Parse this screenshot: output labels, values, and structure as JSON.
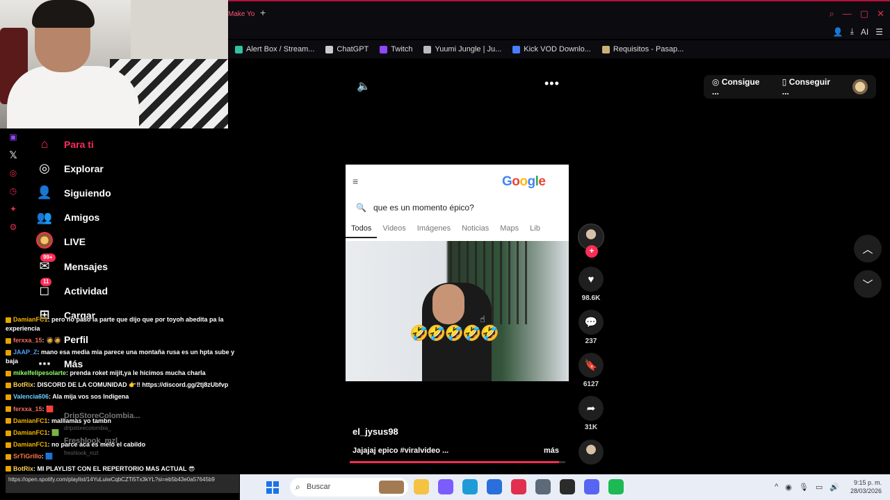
{
  "browser": {
    "tab_label": "Make Yo",
    "new_tab": "+",
    "bookmarks": [
      {
        "label": "Alert Box / Stream...",
        "icon": "streamlabs-icon",
        "color": "#31c3a2"
      },
      {
        "label": "ChatGPT",
        "icon": "chatgpt-icon",
        "color": "#cccccc"
      },
      {
        "label": "Twitch",
        "icon": "twitch-icon",
        "color": "#9146ff"
      },
      {
        "label": "Yuumi Jungle | Ju...",
        "icon": "yuumi-icon",
        "color": "#bbbbbb"
      },
      {
        "label": "Kick VOD Downlo...",
        "icon": "kick-icon",
        "color": "#4a7dff"
      },
      {
        "label": "Requisitos - Pasap...",
        "icon": "passport-icon",
        "color": "#c8b27a"
      }
    ],
    "toolbar_ai": "AI"
  },
  "nav": {
    "items": [
      {
        "label": "Para ti",
        "icon": "home-icon",
        "badge": ""
      },
      {
        "label": "Explorar",
        "icon": "compass-icon",
        "badge": ""
      },
      {
        "label": "Siguiendo",
        "icon": "following-icon",
        "badge": ""
      },
      {
        "label": "Amigos",
        "icon": "friends-icon",
        "badge": ""
      },
      {
        "label": "LIVE",
        "icon": "live-icon",
        "badge": ""
      },
      {
        "label": "Mensajes",
        "icon": "messages-icon",
        "badge": "99+"
      },
      {
        "label": "Actividad",
        "icon": "activity-icon",
        "badge": "11"
      },
      {
        "label": "Cargar",
        "icon": "upload-icon",
        "badge": ""
      },
      {
        "label": "Perfil",
        "icon": "profile-icon",
        "badge": ""
      },
      {
        "label": "Más",
        "icon": "more-icon",
        "badge": ""
      }
    ],
    "faded": [
      {
        "name": "DripStoreColombia...",
        "handle": "dripstorecolombia_"
      },
      {
        "name": "Freshlook_mzl",
        "handle": "freshlook_mzl"
      }
    ]
  },
  "chat": {
    "lines": [
      {
        "user": "DamianFC1",
        "text": ": pero no paso la parte que dijo que por toyoh abedita pa la experiencia",
        "color": "#f4b400"
      },
      {
        "user": "ferxxa_15",
        "text": ": 🧔🧔",
        "color": "#f36d5a"
      },
      {
        "user": "JAAP_Z",
        "text": ": mano esa media mia parece una montaña rusa es un hpta sube y baja",
        "color": "#4da3ff"
      },
      {
        "user": "mikelfelipesolarte",
        "text": ": prenda roket mijit,ya le hicimos mucha charla",
        "color": "#8fff6a"
      },
      {
        "user": "BotRix",
        "text": ": DISCORD DE LA COMUNIDAD 👉‼ https://discord.gg/2tj8zUbfvp",
        "color": "#ffd24a"
      },
      {
        "user": "Valencia606",
        "text": ": Ala mija vos sos Indigena",
        "color": "#6ad1ff"
      },
      {
        "user": "ferxxa_15",
        "text": ": 🟥",
        "color": "#f36d5a"
      },
      {
        "user": "DamianFC1",
        "text": ": malllamas yo tambn",
        "color": "#f4b400"
      },
      {
        "user": "DamianFC1",
        "text": ": 🟩",
        "color": "#f4b400"
      },
      {
        "user": "DamianFC1",
        "text": ": no parce aca es melo el cabildo",
        "color": "#f4b400"
      },
      {
        "user": "SrTiGrillo",
        "text": ": 🟦",
        "color": "#ff7a45"
      },
      {
        "user": "BotRix",
        "text": ": MI PLAYLIST CON EL REPERTORIO MAS ACTUAL 😎",
        "color": "#ffd24a"
      }
    ],
    "url_tooltip": "https://open.spotify.com/playlist/14YuLuiwCqbCZTi5Tx3kYL?si=eb5b43e0a57645b9"
  },
  "video": {
    "top_pill": {
      "btn1": "Consigue ...",
      "btn2": "Conseguir ..."
    },
    "google": {
      "logo_letters": [
        {
          "ch": "G",
          "color": "#4285f4"
        },
        {
          "ch": "o",
          "color": "#ea4335"
        },
        {
          "ch": "o",
          "color": "#fbbc05"
        },
        {
          "ch": "g",
          "color": "#4285f4"
        },
        {
          "ch": "l",
          "color": "#34a853"
        },
        {
          "ch": "e",
          "color": "#ea4335"
        }
      ],
      "query": "que es un momento épico?",
      "tabs": [
        "Todos",
        "Videos",
        "Imágenes",
        "Noticias",
        "Maps",
        "Lib"
      ]
    },
    "emojis": "🤣🤣🤣🤣🤣",
    "author": "el_jysus98",
    "caption": "Jajajaj epico #viralvideo ...",
    "more": "más",
    "progress": 0.97,
    "likes": "98.6K",
    "comments": "237",
    "saves": "6127",
    "shares": "31K",
    "follow_plus": "+"
  },
  "taskbar": {
    "search_placeholder": "Buscar",
    "apps": [
      {
        "name": "file-explorer-icon",
        "color": "#f5c242"
      },
      {
        "name": "copilot-icon",
        "color": "#7a5cff"
      },
      {
        "name": "edge-icon",
        "color": "#1f9bd8"
      },
      {
        "name": "store-icon",
        "color": "#2a6fdb"
      },
      {
        "name": "opera-icon",
        "color": "#e0304e"
      },
      {
        "name": "camera-icon",
        "color": "#5c6a7a"
      },
      {
        "name": "obs-icon",
        "color": "#2b2b2b"
      },
      {
        "name": "discord-icon",
        "color": "#5865f2"
      },
      {
        "name": "spotify-icon",
        "color": "#1db954"
      }
    ],
    "time": "9:15 p. m.",
    "date": "28/03/2026"
  }
}
